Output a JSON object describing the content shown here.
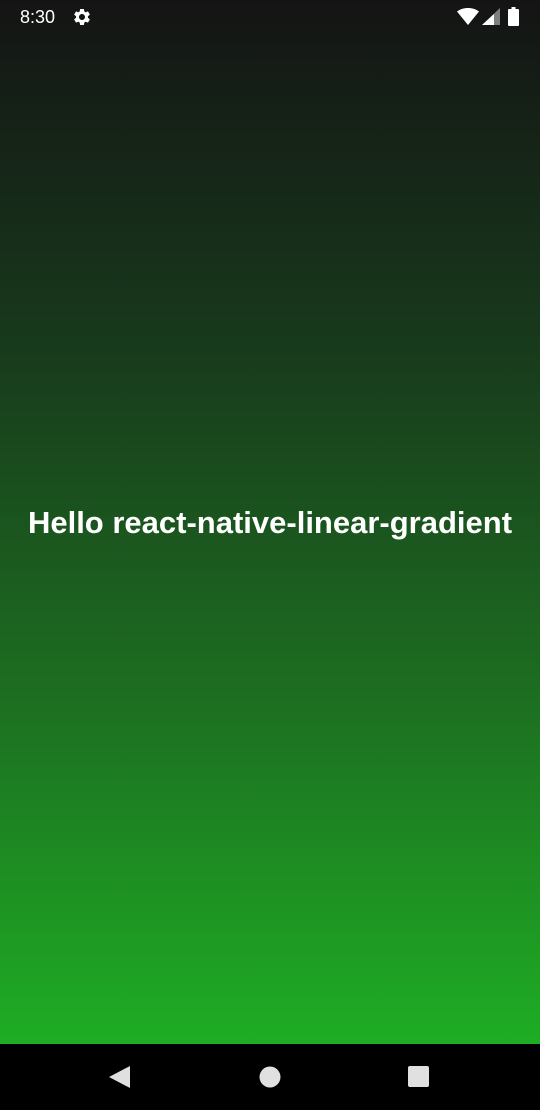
{
  "status_bar": {
    "time": "8:30",
    "icons": [
      "gear-icon",
      "wifi-icon",
      "cell-signal-icon",
      "battery-icon"
    ]
  },
  "main": {
    "text": "Hello react-native-linear-gradient",
    "gradient": {
      "direction": "top-to-bottom",
      "colors": [
        "#141414",
        "#183a1c",
        "#1d6e21",
        "#1ead24"
      ]
    }
  },
  "nav_bar": {
    "buttons": [
      "back-icon",
      "home-icon",
      "recents-icon"
    ],
    "icon_color": "#e0e0e0"
  }
}
